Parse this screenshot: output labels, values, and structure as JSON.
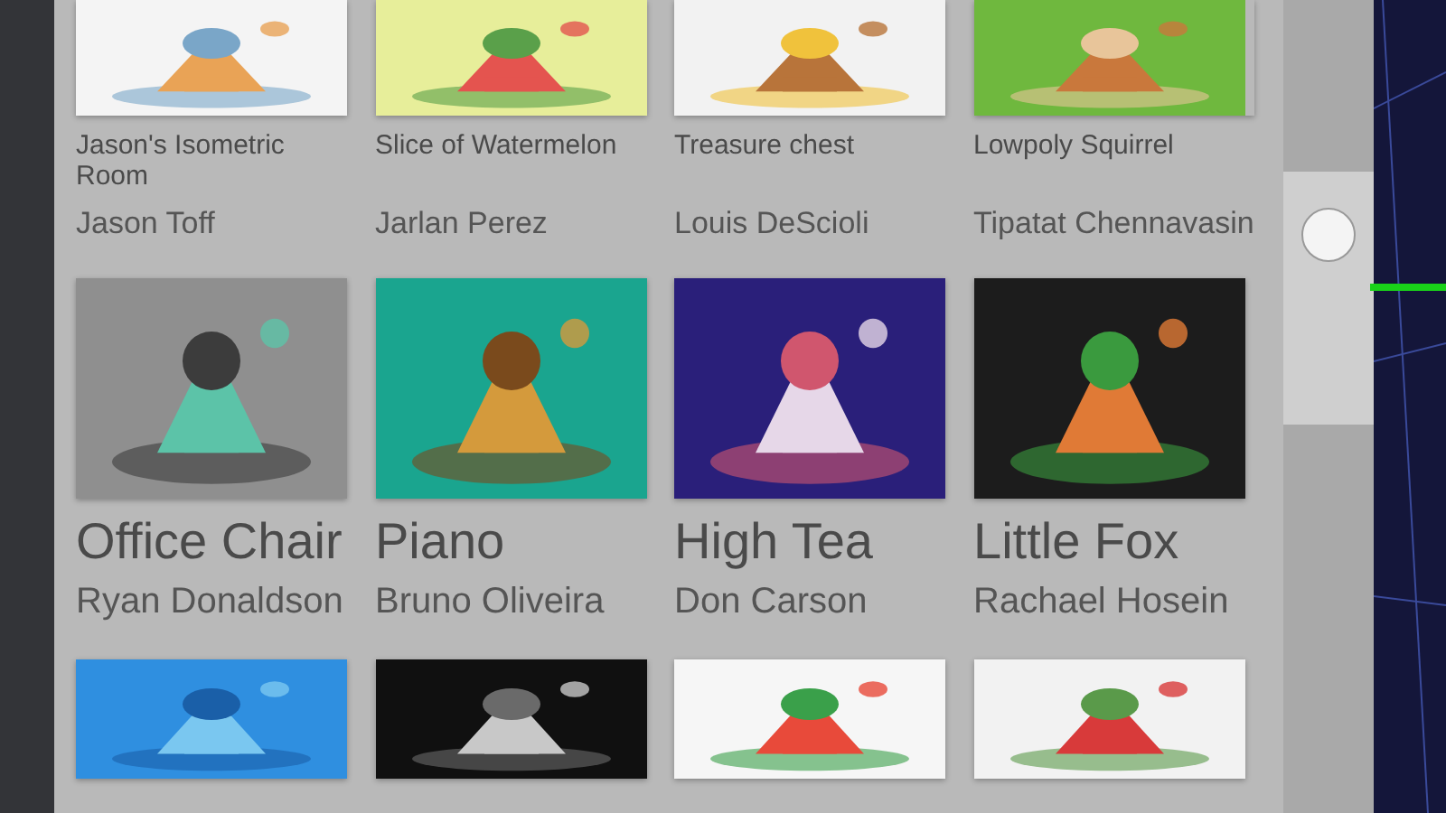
{
  "gallery": {
    "rows": [
      {
        "items": [
          {
            "kind": "picture",
            "title": "Jason's Isometric Room",
            "author": "Jason Toff"
          },
          {
            "kind": "picture",
            "title": "Slice of Watermelon",
            "author": "Jarlan Perez"
          },
          {
            "kind": "picture",
            "title": "Treasure chest",
            "author": "Louis DeScioli"
          },
          {
            "kind": "picture",
            "title": "Lowpoly Squirrel",
            "author": "Tipatat Chennavasin"
          }
        ]
      },
      {
        "items": [
          {
            "kind": "picture",
            "title": "Office Chair",
            "author": "Ryan Donaldson"
          },
          {
            "kind": "picture",
            "title": "Piano",
            "author": "Bruno Oliveira"
          },
          {
            "kind": "picture",
            "title": "High Tea",
            "author": "Don Carson"
          },
          {
            "kind": "picture",
            "title": "Little Fox",
            "author": "Rachael Hosein"
          }
        ]
      },
      {
        "items": [
          {
            "kind": "picture"
          },
          {
            "kind": "picture"
          },
          {
            "kind": "picture"
          },
          {
            "kind": "picture"
          }
        ]
      }
    ]
  }
}
